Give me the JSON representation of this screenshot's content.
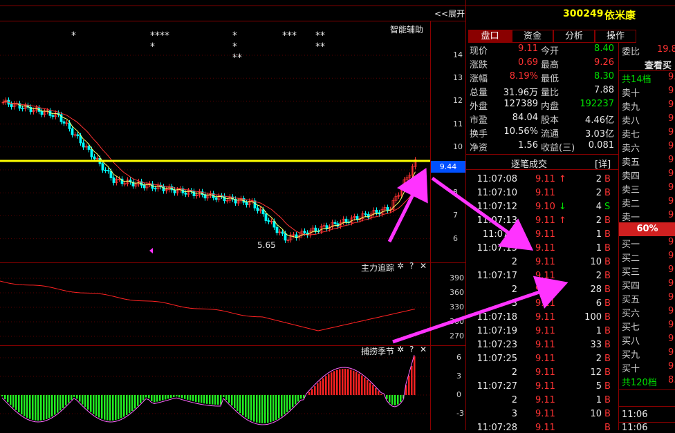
{
  "toolbar": {
    "expand": "<<展开"
  },
  "chart_header": {
    "assist_label": "智能辅助",
    "stars": [
      "*",
      "**** *",
      "* * **",
      "***",
      "** **"
    ]
  },
  "price_axis": {
    "ticks": [
      "14",
      "13",
      "12",
      "11",
      "10",
      "9",
      "8",
      "7",
      "6"
    ],
    "marker": "9.44",
    "low_label": "5.65"
  },
  "ind1": {
    "title": "主力追踪",
    "ticks": [
      "390",
      "360",
      "330",
      "300",
      "270"
    ]
  },
  "ind2": {
    "title": "捕捞季节",
    "ticks": [
      "6",
      "3",
      "0",
      "-3"
    ]
  },
  "icons": {
    "gear": "✲",
    "help": "?",
    "close": "✕"
  },
  "stock": {
    "code": "300249",
    "name": "依米康"
  },
  "tabs": [
    "盘口",
    "资金",
    "分析",
    "操作"
  ],
  "quote": [
    [
      "现价",
      "9.11",
      "今开",
      "8.40"
    ],
    [
      "涨跌",
      "0.69",
      "最高",
      "9.26"
    ],
    [
      "涨幅",
      "8.19%",
      "最低",
      "8.30"
    ],
    [
      "总量",
      "31.96万",
      "量比",
      "7.88"
    ],
    [
      "外盘",
      "127389",
      "内盘",
      "192237"
    ],
    [
      "市盈",
      "84.04",
      "股本",
      "4.46亿"
    ],
    [
      "换手",
      "10.56%",
      "流通",
      "3.03亿"
    ],
    [
      "净资",
      "1.56",
      "收益(三)",
      "0.081"
    ]
  ],
  "trades_header": {
    "title": "逐笔成交",
    "detail": "[详]"
  },
  "trades": [
    [
      "11:07:08",
      "9.11",
      "↑",
      "2",
      "B"
    ],
    [
      "11:07:10",
      "9.11",
      "",
      "2",
      "B"
    ],
    [
      "11:07:12",
      "9.10",
      "↓",
      "4",
      "S"
    ],
    [
      "11:07:13",
      "9.11",
      "↑",
      "2",
      "B"
    ],
    [
      "11:07:1",
      "9.11",
      "",
      "1",
      "B"
    ],
    [
      "11:07:15",
      "9.11",
      "",
      "1",
      "B"
    ],
    [
      "2",
      "9.11",
      "",
      "10",
      "B"
    ],
    [
      "11:07:17",
      "9.11",
      "",
      "2",
      "B"
    ],
    [
      "2",
      "9.11",
      "",
      "28",
      "B"
    ],
    [
      "3",
      "9.11",
      "",
      "6",
      "B"
    ],
    [
      "11:07:18",
      "9.11",
      "",
      "100",
      "B"
    ],
    [
      "11:07:19",
      "9.11",
      "",
      "1",
      "B"
    ],
    [
      "11:07:23",
      "9.11",
      "",
      "33",
      "B"
    ],
    [
      "11:07:25",
      "9.11",
      "",
      "2",
      "B"
    ],
    [
      "2",
      "9.11",
      "",
      "12",
      "B"
    ],
    [
      "11:07:27",
      "9.11",
      "",
      "5",
      "B"
    ],
    [
      "2",
      "9.11",
      "",
      "1",
      "B"
    ],
    [
      "3",
      "9.11",
      "",
      "10",
      "B"
    ],
    [
      "11:07:28",
      "9.11",
      "",
      "",
      "B"
    ]
  ],
  "orderbook": {
    "ratio_label": "委比",
    "ratio_value": "19.8",
    "view_label": "查看买",
    "sell_total": "共14档",
    "sell_total_val": "9.",
    "sells": [
      "卖十",
      "卖九",
      "卖八",
      "卖七",
      "卖六",
      "卖五",
      "卖四",
      "卖三",
      "卖二",
      "卖一"
    ],
    "sell_vals": [
      "9",
      "9",
      "9",
      "9",
      "9",
      "9",
      "9",
      "9",
      "9",
      "9"
    ],
    "pct": "60%",
    "buys": [
      "买一",
      "买二",
      "买三",
      "买四",
      "买五",
      "买六",
      "买七",
      "买八",
      "买九",
      "买十"
    ],
    "buy_vals": [
      "9",
      "9",
      "9",
      "9",
      "9",
      "9",
      "9",
      "9",
      "9",
      "9"
    ],
    "buy_total": "共120档",
    "buy_total_val": "8.",
    "time1": "11:06",
    "time2": "11:06"
  },
  "colors": {
    "bull": "#ff3333",
    "bear": "#00ffff",
    "ma1": "#ffff66",
    "ma2": "#ff3333",
    "hline": "#ffff00",
    "arrow": "#ff33ff"
  }
}
